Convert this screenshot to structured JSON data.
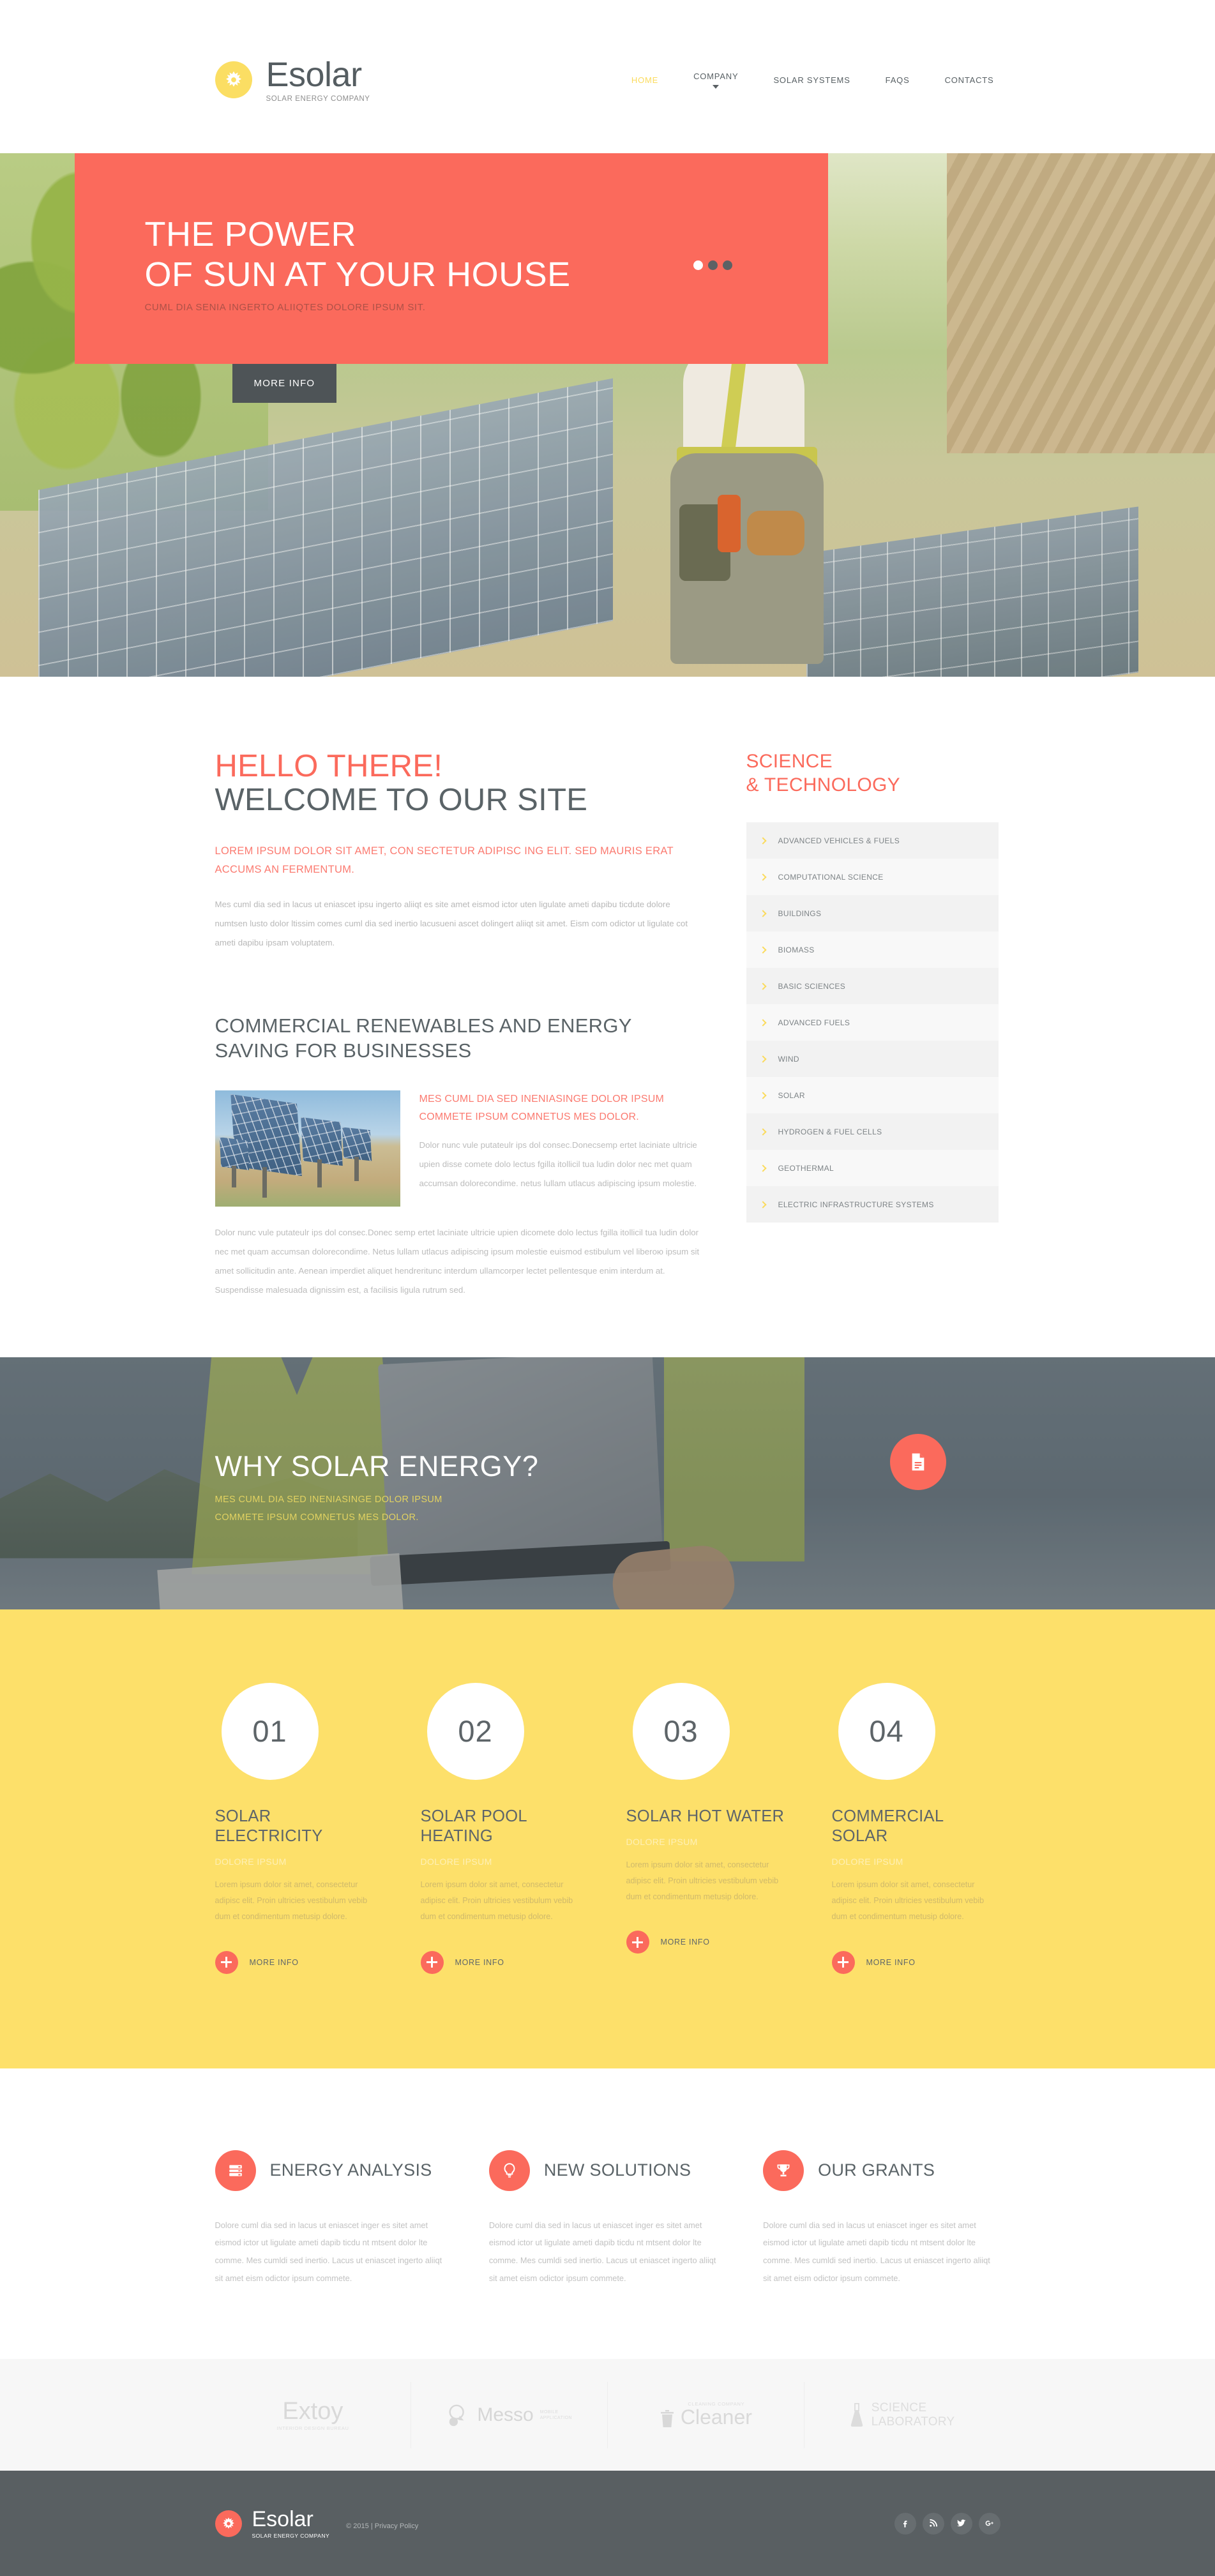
{
  "brand": {
    "name": "Esolar",
    "tagline": "SOLAR ENERGY COMPANY",
    "accent_red": "#FB6A5C",
    "accent_yellow": "#FDE06A",
    "logo_icon": "sun-icon"
  },
  "nav": {
    "items": [
      {
        "label": "HOME",
        "active": true,
        "has_dropdown": false
      },
      {
        "label": "COMPANY",
        "active": false,
        "has_dropdown": true
      },
      {
        "label": "SOLAR SYSTEMS",
        "active": false,
        "has_dropdown": false
      },
      {
        "label": "FAQS",
        "active": false,
        "has_dropdown": false
      },
      {
        "label": "CONTACTS",
        "active": false,
        "has_dropdown": false
      }
    ]
  },
  "hero": {
    "title_line1": "THE POWER",
    "title_line2": "OF SUN AT YOUR HOUSE",
    "subtitle": "CUML DIA SENIA INGERTO ALIIQTES DOLORE IPSUM SIT.",
    "button": "MORE INFO",
    "slides": 3,
    "active_slide": 1
  },
  "welcome": {
    "heading_red": "HELLO THERE!",
    "heading_dark": "WELCOME TO OUR SITE",
    "lead": "LOREM IPSUM DOLOR SIT AMET, CON SECTETUR ADIPISC ING ELIT. SED MAURIS ERAT ACCUMS AN FERMENTUM.",
    "body": "Mes cuml dia sed in lacus ut eniascet ipsu ingerto aliiqt es site amet eismod ictor uten ligulate ameti dapibu ticdute dolore numtsen lusto dolor ltissim comes cuml dia sed inertio lacusueni ascet dolingert aliiqt sit amet. Eism com odictor ut ligulate cot ameti dapibu ipsam voluptatem."
  },
  "article": {
    "heading": "COMMERCIAL RENEWABLES AND ENERGY SAVING FOR BUSINESSES",
    "image_alt": "solar-panel-array-photo",
    "kicker": "MES CUML DIA SED INENIASINGE DOLOR IPSUM COMMETE IPSUM COMNETUS MES DOLOR.",
    "body": "Dolor nunc vule putateulr ips dol consec.Donecsemp ertet laciniate ultricie upien disse comete dolo lectus fgilla itollicil tua ludin dolor nec met quam accumsan dolorecondime. netus lullam utlacus adipiscing ipsum molestie.",
    "tail": "Dolor nunc vule putateulr ips dol consec.Donec semp ertet laciniate ultricie upien dicomete dolo lectus fgilla itollicil tua ludin dolor nec met quam accumsan dolorecondime. Netus lullam utlacus adipiscing ipsum molestie euismod estibulum vel liberoю ipsum sit amet sollicitudin ante. Aenean imperdiet aliquet hendreritunc interdum ullamcorper lectet pellentesque enim interdum at. Suspendisse malesuada dignissim est, a facilisis ligula rutrum sed."
  },
  "sidebar": {
    "title_line1": "SCIENCE",
    "title_line2": "& TECHNOLOGY",
    "items": [
      {
        "label": "ADVANCED VEHICLES & FUELS"
      },
      {
        "label": "COMPUTATIONAL SCIENCE"
      },
      {
        "label": "BUILDINGS"
      },
      {
        "label": "BIOMASS"
      },
      {
        "label": "BASIC SCIENCES"
      },
      {
        "label": "ADVANCED FUELS"
      },
      {
        "label": "WIND"
      },
      {
        "label": "SOLAR"
      },
      {
        "label": "HYDROGEN & FUEL CELLS"
      },
      {
        "label": "GEOTHERMAL"
      },
      {
        "label": "ELECTRIC INFRASTRUCTURE SYSTEMS"
      }
    ]
  },
  "why": {
    "title": "WHY SOLAR ENERGY?",
    "sub_line1": "MES CUML DIA SED INENIASINGE DOLOR IPSUM",
    "sub_line2": "COMMETE IPSUM COMNETUS MES DOLOR.",
    "button_icon": "document-icon"
  },
  "services": {
    "items": [
      {
        "number": "01",
        "title": "SOLAR ELECTRICITY",
        "kicker": "DOLORE IPSUM",
        "body": "Lorem ipsum dolor sit amet, consectetur adipisc elit. Proin ultricies vestibulum vebib dum et condimentum metusip dolore.",
        "more": "MORE INFO"
      },
      {
        "number": "02",
        "title": "SOLAR POOL HEATING",
        "kicker": "DOLORE IPSUM",
        "body": "Lorem ipsum dolor sit amet, consectetur adipisc elit. Proin ultricies vestibulum vebib dum et condimentum metusip dolore.",
        "more": "MORE INFO"
      },
      {
        "number": "03",
        "title": "SOLAR HOT WATER",
        "kicker": "DOLORE IPSUM",
        "body": "Lorem ipsum dolor sit amet, consectetur adipisc elit. Proin ultricies vestibulum vebib dum et condimentum metusip dolore.",
        "more": "MORE INFO"
      },
      {
        "number": "04",
        "title": "COMMERCIAL SOLAR",
        "kicker": "DOLORE IPSUM",
        "body": "Lorem ipsum dolor sit amet, consectetur adipisc elit. Proin ultricies vestibulum vebib dum et condimentum metusip dolore.",
        "more": "MORE INFO"
      }
    ]
  },
  "features": {
    "items": [
      {
        "icon": "server-icon",
        "title": "ENERGY ANALYSIS",
        "body": "Dolore cuml dia sed in lacus ut eniascet inger es sitet amet eismod ictor ut ligulate ameti dapib ticdu nt mtsent dolor lte comme. Mes cumldi sed inertio. Lacus ut eniascet ingerto aliiqt sit amet eism odictor ipsum commete."
      },
      {
        "icon": "lightbulb-icon",
        "title": "NEW SOLUTIONS",
        "body": "Dolore cuml dia sed in lacus ut eniascet inger es sitet amet eismod ictor ut ligulate ameti dapib ticdu nt mtsent dolor lte comme. Mes cumldi sed inertio. Lacus ut eniascet ingerto aliiqt sit amet eism odictor ipsum commete."
      },
      {
        "icon": "trophy-icon",
        "title": "OUR GRANTS",
        "body": "Dolore cuml dia sed in lacus ut eniascet inger es sitet amet eismod ictor ut ligulate ameti dapib ticdu nt mtsent dolor lte comme. Mes cumldi sed inertio. Lacus ut eniascet ingerto aliiqt sit amet eism odictor ipsum commete."
      }
    ]
  },
  "partners": {
    "items": [
      {
        "name": "Extoy",
        "sub": "INTERIOR DESIGN BUREAU",
        "icon": "none"
      },
      {
        "name": "Messo",
        "sub_line1": "MOBILE",
        "sub_line2": "APPLICATION",
        "icon": "speech-bubble-icon"
      },
      {
        "name": "Cleaner",
        "sub": "CLEANING COMPANY",
        "icon": "trash-bin-icon"
      },
      {
        "name_line1": "SCIENCE",
        "name_line2": "LABORATORY",
        "icon": "flask-icon"
      }
    ]
  },
  "footer": {
    "brand": "Esolar",
    "tagline": "SOLAR ENERGY COMPANY",
    "copyright": "© 2015 | Privacy Policy",
    "social": [
      {
        "name": "facebook-icon",
        "glyph": "f"
      },
      {
        "name": "rss-icon",
        "glyph": "rss"
      },
      {
        "name": "twitter-icon",
        "glyph": "t"
      },
      {
        "name": "google-plus-icon",
        "glyph": "g+"
      }
    ]
  }
}
